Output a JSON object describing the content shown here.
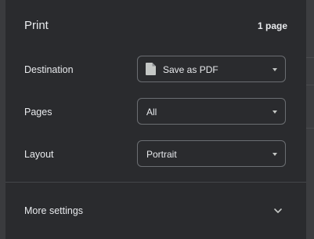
{
  "header": {
    "title": "Print",
    "page_count": "1 page"
  },
  "destination": {
    "label": "Destination",
    "value": "Save as PDF",
    "icon": "file-icon"
  },
  "pages": {
    "label": "Pages",
    "value": "All"
  },
  "layout": {
    "label": "Layout",
    "value": "Portrait"
  },
  "more_settings": {
    "label": "More settings",
    "icon": "chevron-down-icon"
  },
  "colors": {
    "panel_bg": "#2a2b2e",
    "text": "#e8eaed",
    "border": "#6b6e72"
  }
}
